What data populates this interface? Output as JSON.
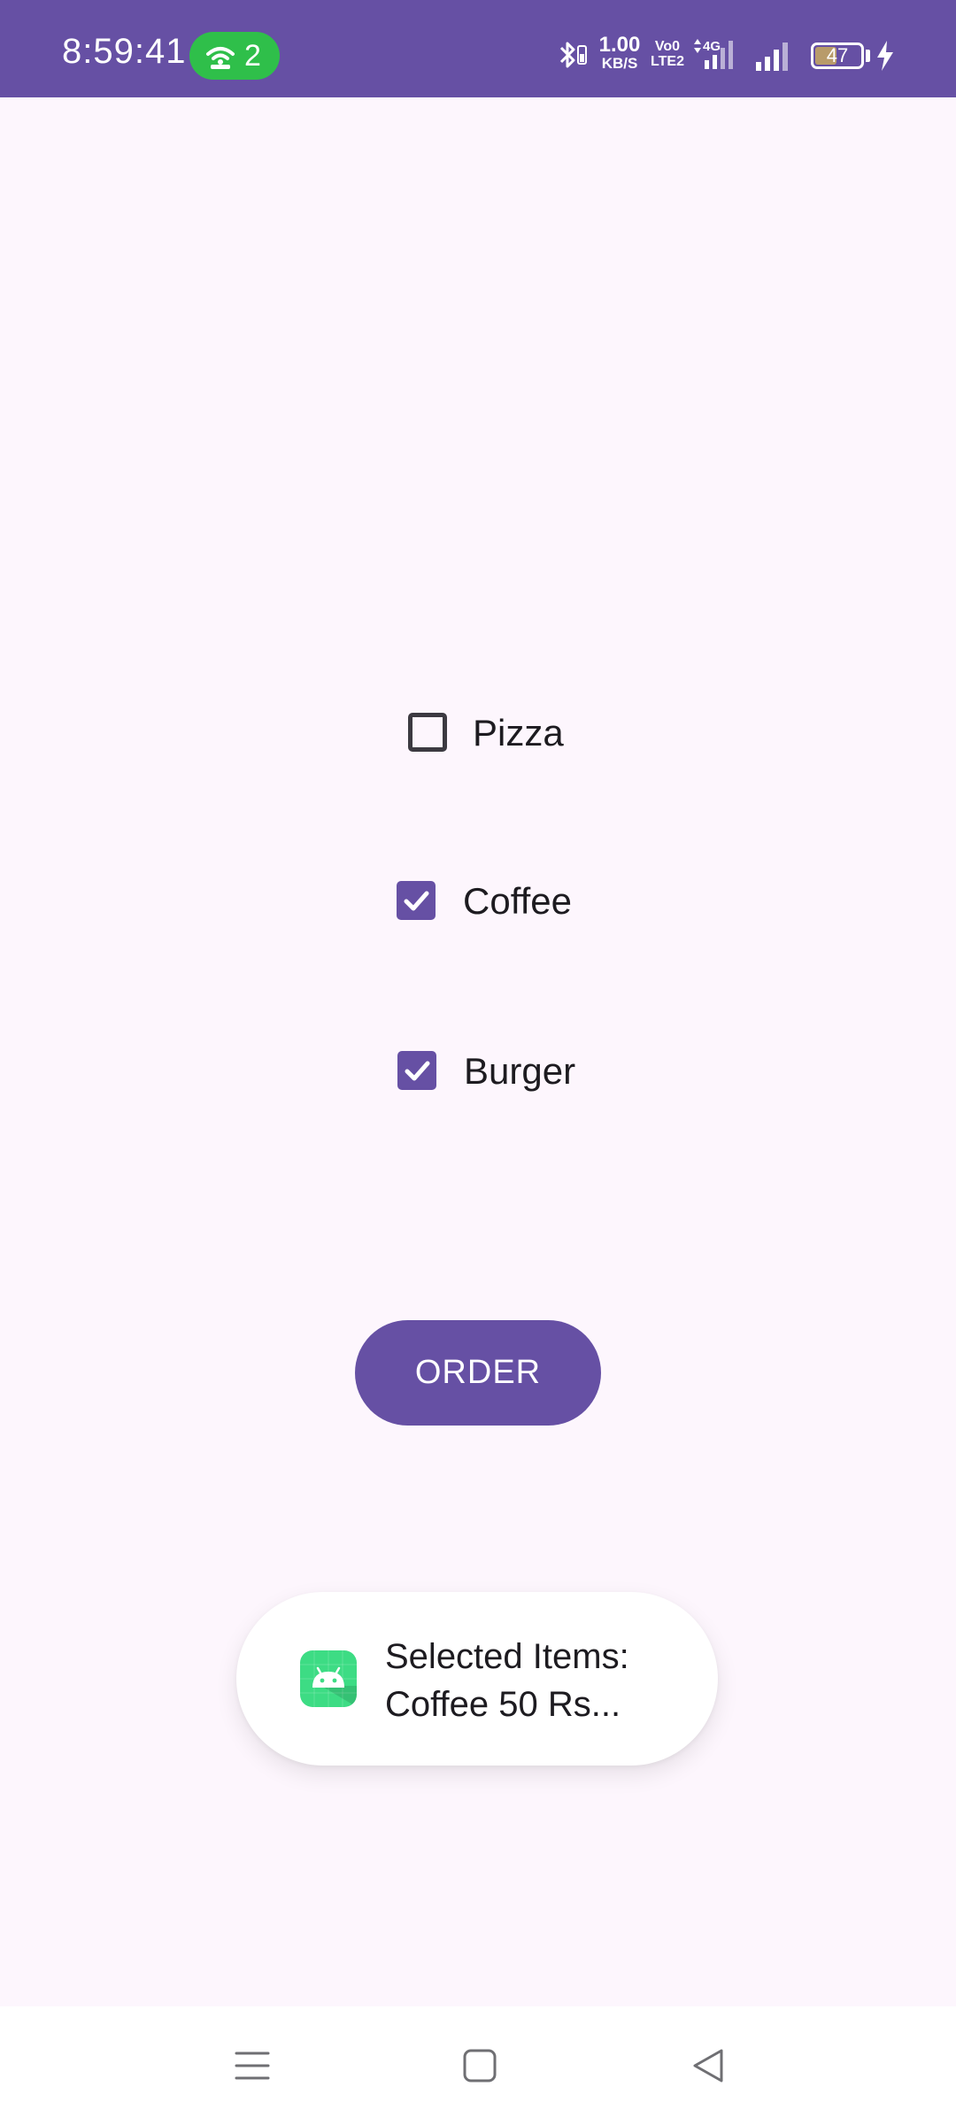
{
  "status_bar": {
    "time": "8:59:41",
    "hotspot_count": "2",
    "network_speed_value": "1.00",
    "network_speed_unit": "KB/S",
    "volte_line1": "Vo0",
    "volte_line2": "LTE2",
    "network_type": "4G",
    "battery_level": "47",
    "background_color": "#6650a4",
    "icons": [
      "hotspot-icon",
      "bluetooth-icon",
      "signal-icon",
      "charging-icon"
    ]
  },
  "checkboxes": [
    {
      "label": "Pizza",
      "checked": false
    },
    {
      "label": "Coffee",
      "checked": true
    },
    {
      "label": "Burger",
      "checked": true
    }
  ],
  "order_button": {
    "label": "ORDER",
    "color": "#6650a4"
  },
  "toast": {
    "line1": "Selected Items:",
    "line2": "Coffee 50 Rs...",
    "icon": "android-app-icon"
  },
  "nav_bar": {
    "icons": [
      "menu-icon",
      "home-icon",
      "back-icon"
    ]
  },
  "colors": {
    "accent": "#6650a4",
    "background": "#fdf6fd",
    "text": "#1d1b20"
  }
}
